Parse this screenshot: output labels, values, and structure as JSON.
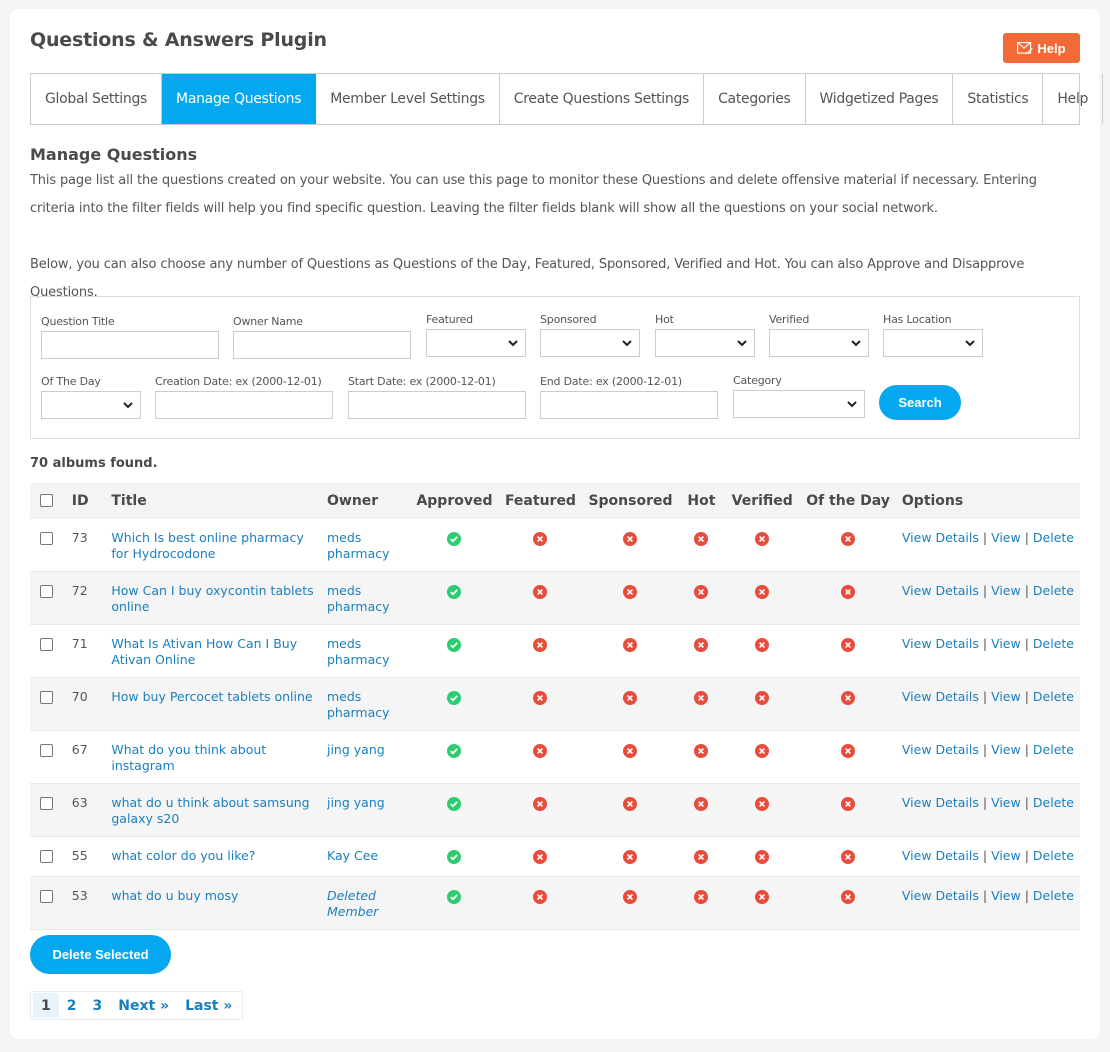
{
  "header": {
    "title": "Questions & Answers Plugin",
    "help_button": "Help",
    "help_icon": "mail-edit-icon"
  },
  "tabs": [
    {
      "label": "Global Settings",
      "active": false
    },
    {
      "label": "Manage Questions",
      "active": true
    },
    {
      "label": "Member Level Settings",
      "active": false
    },
    {
      "label": "Create Questions Settings",
      "active": false
    },
    {
      "label": "Categories",
      "active": false
    },
    {
      "label": "Widgetized Pages",
      "active": false
    },
    {
      "label": "Statistics",
      "active": false
    },
    {
      "label": "Help",
      "active": false
    }
  ],
  "section": {
    "title": "Manage Questions",
    "description": "This page list all the questions created on your website. You can use this page to monitor these Questions and delete offensive material if necessary. Entering criteria into the filter fields will help you find specific question. Leaving the filter fields blank will show all the questions on your social network.",
    "description2": "Below, you can also choose any number of Questions as Questions of the Day, Featured, Sponsored, Verified and Hot. You can also Approve and Disapprove Questions."
  },
  "filters": {
    "question_title": {
      "label": "Question Title",
      "value": ""
    },
    "owner_name": {
      "label": "Owner Name",
      "value": ""
    },
    "featured": {
      "label": "Featured",
      "value": ""
    },
    "sponsored": {
      "label": "Sponsored",
      "value": ""
    },
    "hot": {
      "label": "Hot",
      "value": ""
    },
    "verified": {
      "label": "Verified",
      "value": ""
    },
    "has_location": {
      "label": "Has Location",
      "value": ""
    },
    "of_the_day": {
      "label": "Of The Day",
      "value": ""
    },
    "creation_date": {
      "label": "Creation Date: ex (2000-12-01)",
      "value": ""
    },
    "start_date": {
      "label": "Start Date: ex (2000-12-01)",
      "value": ""
    },
    "end_date": {
      "label": "End Date: ex (2000-12-01)",
      "value": ""
    },
    "category": {
      "label": "Category",
      "value": ""
    },
    "search_button": "Search"
  },
  "results": {
    "count_text": "70 albums found.",
    "columns": [
      "ID",
      "Title",
      "Owner",
      "Approved",
      "Featured",
      "Sponsored",
      "Hot",
      "Verified",
      "Of the Day",
      "Options"
    ],
    "rows": [
      {
        "id": "73",
        "title": "Which Is best online pharmacy for Hydrocodone",
        "owner": "meds pharmacy",
        "owner_deleted": false,
        "approved": true,
        "featured": false,
        "sponsored": false,
        "hot": false,
        "verified": false,
        "of_the_day": false
      },
      {
        "id": "72",
        "title": "How Can I buy oxycontin tablets online",
        "owner": "meds pharmacy",
        "owner_deleted": false,
        "approved": true,
        "featured": false,
        "sponsored": false,
        "hot": false,
        "verified": false,
        "of_the_day": false
      },
      {
        "id": "71",
        "title": "What Is Ativan How Can I Buy Ativan Online",
        "owner": "meds pharmacy",
        "owner_deleted": false,
        "approved": true,
        "featured": false,
        "sponsored": false,
        "hot": false,
        "verified": false,
        "of_the_day": false
      },
      {
        "id": "70",
        "title": "How buy Percocet tablets online",
        "owner": "meds pharmacy",
        "owner_deleted": false,
        "approved": true,
        "featured": false,
        "sponsored": false,
        "hot": false,
        "verified": false,
        "of_the_day": false
      },
      {
        "id": "67",
        "title": "What do you think about instagram",
        "owner": "jing yang",
        "owner_deleted": false,
        "approved": true,
        "featured": false,
        "sponsored": false,
        "hot": false,
        "verified": false,
        "of_the_day": false
      },
      {
        "id": "63",
        "title": "what do u think about samsung galaxy s20",
        "owner": "jing yang",
        "owner_deleted": false,
        "approved": true,
        "featured": false,
        "sponsored": false,
        "hot": false,
        "verified": false,
        "of_the_day": false
      },
      {
        "id": "55",
        "title": "what color do you like?",
        "owner": "Kay Cee",
        "owner_deleted": false,
        "approved": true,
        "featured": false,
        "sponsored": false,
        "hot": false,
        "verified": false,
        "of_the_day": false
      },
      {
        "id": "53",
        "title": "what do u buy mosy",
        "owner": "Deleted Member",
        "owner_deleted": true,
        "approved": true,
        "featured": false,
        "sponsored": false,
        "hot": false,
        "verified": false,
        "of_the_day": false
      }
    ],
    "options": {
      "view_details": "View Details",
      "view": "View",
      "delete": "Delete",
      "separator": "|"
    }
  },
  "actions": {
    "delete_selected": "Delete Selected"
  },
  "pagination": {
    "current": "1",
    "pages": [
      "2",
      "3"
    ],
    "next": "Next »",
    "last": "Last »"
  },
  "colors": {
    "accent": "#05a8ef",
    "help_button": "#f26b36",
    "link": "#1a7fbf",
    "yes": "#2ecc71",
    "no": "#e74c3c"
  }
}
